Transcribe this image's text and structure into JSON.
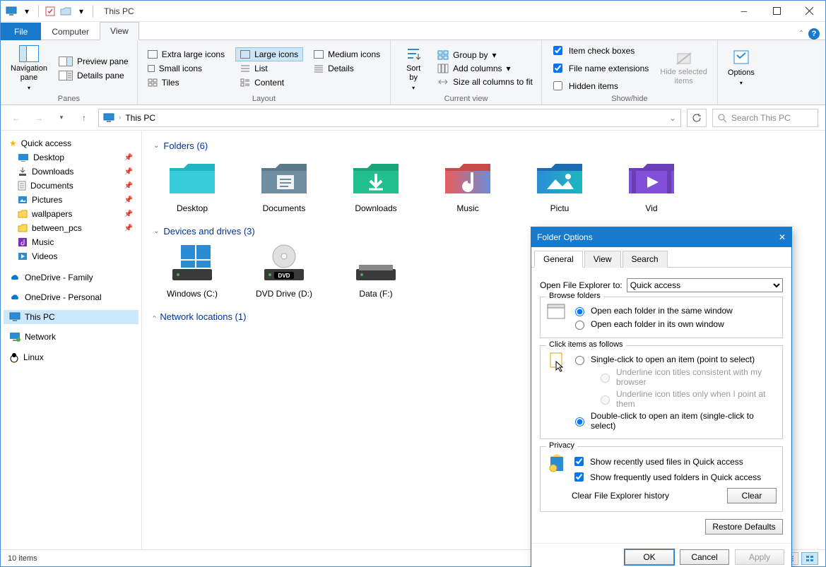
{
  "title": "This PC",
  "tabs": {
    "file": "File",
    "computer": "Computer",
    "view": "View"
  },
  "ribbon": {
    "panes": {
      "nav": "Navigation\npane",
      "preview": "Preview pane",
      "details": "Details pane",
      "label": "Panes"
    },
    "layout": {
      "xl": "Extra large icons",
      "lg": "Large icons",
      "md": "Medium icons",
      "sm": "Small icons",
      "list": "List",
      "det": "Details",
      "tiles": "Tiles",
      "content": "Content",
      "label": "Layout"
    },
    "current": {
      "sort": "Sort\nby",
      "group": "Group by",
      "addcol": "Add columns",
      "size": "Size all columns to fit",
      "label": "Current view"
    },
    "show": {
      "chk": "Item check boxes",
      "ext": "File name extensions",
      "hidden": "Hidden items",
      "hide": "Hide selected\nitems",
      "label": "Show/hide"
    },
    "options": "Options"
  },
  "address": "This PC",
  "search_placeholder": "Search This PC",
  "sidebar": {
    "quick": "Quick access",
    "items": [
      "Desktop",
      "Downloads",
      "Documents",
      "Pictures",
      "wallpapers",
      "between_pcs",
      "Music",
      "Videos"
    ],
    "od_family": "OneDrive - Family",
    "od_personal": "OneDrive - Personal",
    "thispc": "This PC",
    "network": "Network",
    "linux": "Linux"
  },
  "sections": {
    "folders": "Folders (6)",
    "drives": "Devices and drives (3)",
    "network": "Network locations (1)"
  },
  "folders": [
    "Desktop",
    "Documents",
    "Downloads",
    "Music",
    "Pictu",
    "Vid"
  ],
  "drives": [
    "Windows (C:)",
    "DVD Drive (D:)",
    "Data (F:)"
  ],
  "status": "10 items",
  "dialog": {
    "title": "Folder Options",
    "tabs": {
      "general": "General",
      "view": "View",
      "search": "Search"
    },
    "open_label": "Open File Explorer to:",
    "open_value": "Quick access",
    "browse": {
      "legend": "Browse folders",
      "same": "Open each folder in the same window",
      "own": "Open each folder in its own window"
    },
    "click": {
      "legend": "Click items as follows",
      "single": "Single-click to open an item (point to select)",
      "u1": "Underline icon titles consistent with my browser",
      "u2": "Underline icon titles only when I point at them",
      "double": "Double-click to open an item (single-click to select)"
    },
    "privacy": {
      "legend": "Privacy",
      "recent": "Show recently used files in Quick access",
      "freq": "Show frequently used folders in Quick access",
      "clear_label": "Clear File Explorer history",
      "clear": "Clear"
    },
    "restore": "Restore Defaults",
    "ok": "OK",
    "cancel": "Cancel",
    "apply": "Apply"
  }
}
